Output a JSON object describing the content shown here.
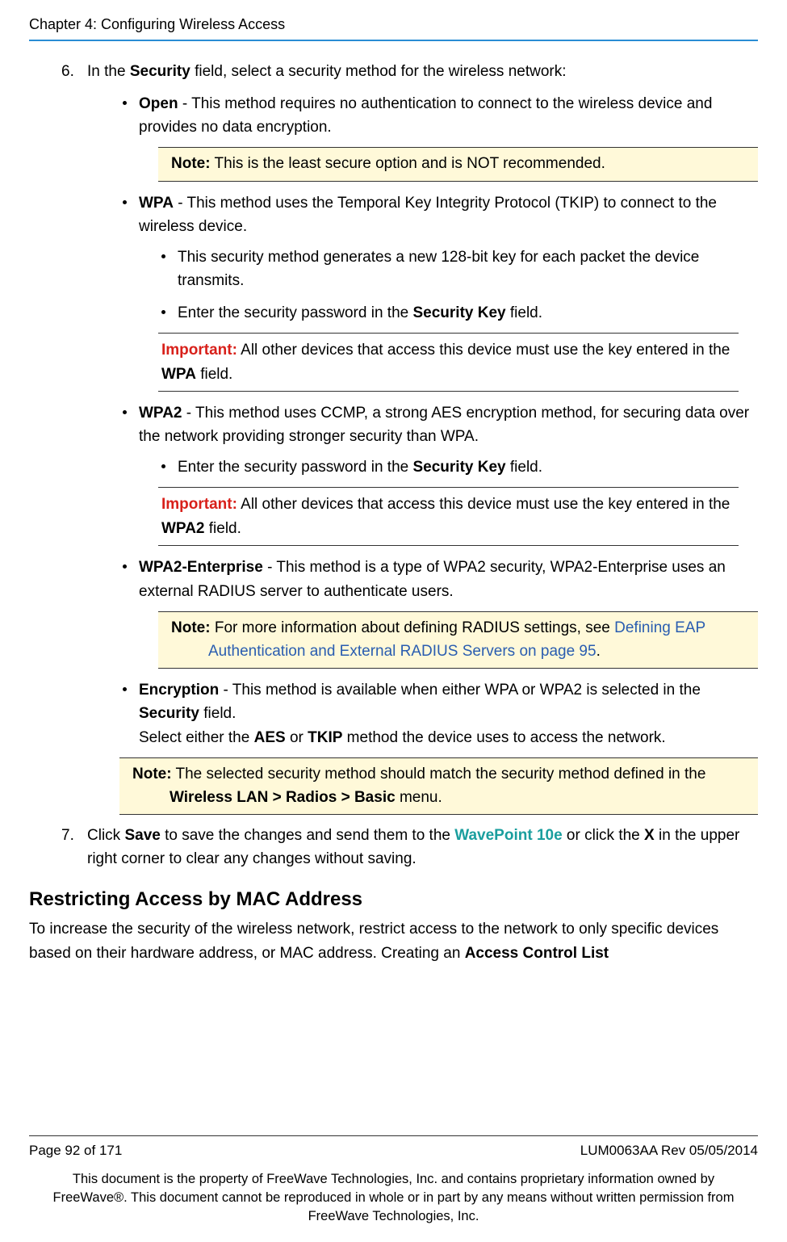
{
  "header": {
    "chapter": "Chapter 4: Configuring Wireless Access"
  },
  "steps": {
    "six": {
      "num": "6.",
      "intro_pre": "In the ",
      "intro_bold": "Security",
      "intro_post": " field, select a security method for the wireless network:",
      "open": {
        "label": "Open",
        "desc": " - This method requires no authentication to connect to the wireless device and provides no data encryption.",
        "note_label": "Note:",
        "note_text": " This is the least secure option and is NOT recommended."
      },
      "wpa": {
        "label": "WPA",
        "desc": " - This method uses the Temporal Key Integrity Protocol (TKIP) to connect to the wireless device.",
        "sub1": "This security method generates a new 128-bit key for each packet the device transmits.",
        "sub2_pre": "Enter the security password in the ",
        "sub2_bold": "Security Key",
        "sub2_post": " field.",
        "important_label": "Important:",
        "important_pre": " All other devices that access this device must use the key entered in the ",
        "important_bold": "WPA",
        "important_post": " field."
      },
      "wpa2": {
        "label": "WPA2",
        "desc": " - This method uses CCMP, a strong AES encryption method, for securing data over the network providing stronger security than WPA.",
        "sub1_pre": "Enter the security password in the ",
        "sub1_bold": "Security Key",
        "sub1_post": " field.",
        "important_label": "Important:",
        "important_pre": " All other devices that access this device must use the key entered in the ",
        "important_bold": "WPA2",
        "important_post": " field."
      },
      "wpa2ent": {
        "label": "WPA2-Enterprise",
        "desc": " - This method is a type of WPA2 security, WPA2-Enterprise uses an external RADIUS server to authenticate users.",
        "note_label": "Note:",
        "note_pre": " For more information about defining RADIUS settings, see  ",
        "note_link": "Defining EAP Authentication and External RADIUS Servers on page 95",
        "note_post": "."
      },
      "encryption": {
        "label": "Encryption ",
        "desc_pre": " - This method is available when either WPA or WPA2 is selected in the ",
        "desc_bold": "Security",
        "desc_post": " field.",
        "line2_pre": "Select either the ",
        "line2_bold1": "AES",
        "line2_mid": " or ",
        "line2_bold2": "TKIP",
        "line2_post": " method the device uses to access the network."
      },
      "final_note": {
        "label": "Note:",
        "pre": " The selected security method should match the security method defined in the ",
        "bold": "Wireless LAN > Radios > Basic",
        "post": " menu."
      }
    },
    "seven": {
      "num": "7.",
      "pre": "Click ",
      "bold1": "Save",
      "mid1": " to save the changes and send them to the ",
      "teal": "WavePoint 10e",
      "mid2": " or click the ",
      "bold2": "X",
      "post": " in the upper right corner to clear any changes without saving."
    }
  },
  "section": {
    "heading": "Restricting Access by MAC Address",
    "para_pre": "To increase the security of the wireless network, restrict access to the network to only specific devices based on their hardware address, or MAC address. Creating an ",
    "para_bold": "Access Control List"
  },
  "footer": {
    "page": "Page 92 of 171",
    "rev": "LUM0063AA Rev 05/05/2014",
    "legal": "This document is the property of FreeWave Technologies, Inc. and contains proprietary information owned by FreeWave®. This document cannot be reproduced in whole or in part by any means without written permission from FreeWave Technologies, Inc."
  }
}
